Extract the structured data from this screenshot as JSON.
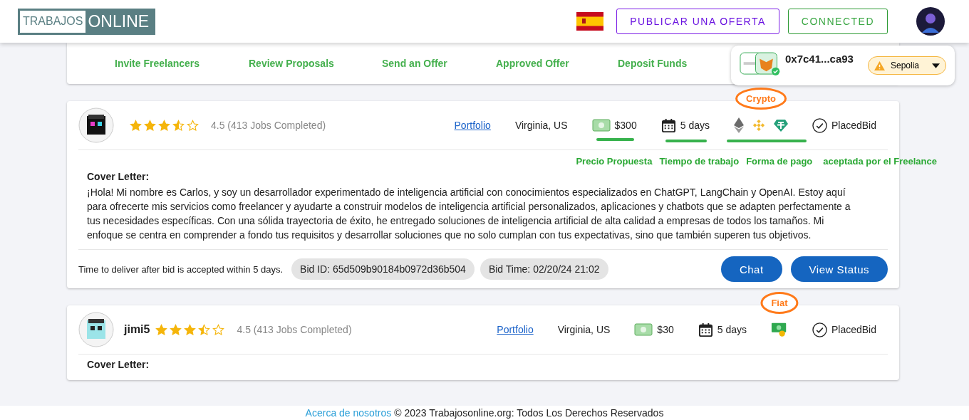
{
  "header": {
    "logo": {
      "left": "TRABAJOS",
      "right": "ONLINE"
    },
    "post_button": "PUBLICAR UNA OFERTA",
    "connect_button": "CONNECTED"
  },
  "steps": [
    {
      "label": "Invite Freelancers"
    },
    {
      "label": "Review Proposals"
    },
    {
      "label": "Send an Offer"
    },
    {
      "label": "Approved Offer"
    },
    {
      "label": "Deposit Funds"
    }
  ],
  "wallet": {
    "address": "0x7c41...ca93",
    "network": "Sepolia",
    "connected": true
  },
  "bids": [
    {
      "stars": 3.5,
      "rating": "4.5 (413 Jobs Completed)",
      "portfolio": "Portfolio",
      "location": "Virginia, US",
      "price": "$300",
      "days": "5 days",
      "payment": {
        "kind": "crypto",
        "note": "Crypto"
      },
      "highlighted": true,
      "status": "PlacedBid",
      "annotations": [
        "Precio Propuesta",
        "Tiempo de trabajo",
        "Forma de pago",
        "aceptada por el Freelance"
      ],
      "cover_title": "Cover Letter:",
      "cover_text": "¡Hola! Mi nombre es Carlos, y soy un desarrollador experimentado de inteligencia artificial con conocimientos especializados en ChatGPT, LangChain y OpenAI. Estoy aquí para ofrecerte mis servicios como freelancer y ayudarte a construir modelos de inteligencia artificial personalizados, aplicaciones y chatbots que se adapten perfectamente a tus necesidades específicas. Con una sólida trayectoria de éxito, he entregado soluciones de inteligencia artificial de alta calidad a empresas de todos los tamaños. Mi enfoque se centra en comprender a fondo tus requisitos y desarrollar soluciones que no solo cumplan con tus expectativas, sino que también superen tus objetivos.",
      "delivery": "Time to deliver after bid is accepted within 5 days.",
      "bid_id": "Bid ID: 65d509b90184b0972d36b504",
      "bid_time": "Bid Time: 02/20/24 21:02",
      "actions": [
        "Chat",
        "View Status"
      ]
    },
    {
      "name": "jimi5",
      "stars": 3.5,
      "rating": "4.5 (413 Jobs Completed)",
      "portfolio": "Portfolio",
      "location": "Virginia, US",
      "price": "$30",
      "days": "5 days",
      "payment": {
        "kind": "fiat",
        "note": "Fiat"
      },
      "highlighted": false,
      "status": "PlacedBid",
      "cover_title": "Cover Letter:"
    }
  ],
  "footer": {
    "link": "Acerca de nosotros",
    "text": "© 2023 Trabajosonline.org: Todos Los Derechos Reservados"
  }
}
